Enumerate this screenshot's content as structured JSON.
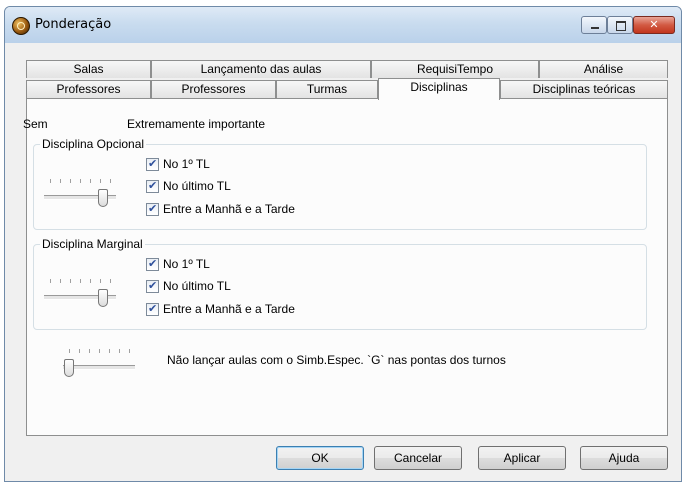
{
  "window": {
    "title": "Ponderação",
    "controls": {
      "minimize": "minimize",
      "maximize": "maximize",
      "close": "close"
    }
  },
  "tabs": {
    "row1": [
      "Salas",
      "Lançamento das aulas",
      "RequisiTempo",
      "Análise"
    ],
    "row2": [
      "Professores",
      "Professores",
      "Turmas",
      "Disciplinas",
      "Disciplinas teóricas"
    ],
    "active": "Disciplinas"
  },
  "panel": {
    "scale_min_label": "Sem",
    "scale_max_label": "Extremamente importante",
    "group_opcional": {
      "title": "Disciplina Opcional",
      "slider_value": 0.85,
      "checks": [
        {
          "label": "No 1º TL",
          "checked": true
        },
        {
          "label": "No último TL",
          "checked": true
        },
        {
          "label": "Entre a Manhã e a Tarde",
          "checked": true
        }
      ]
    },
    "group_marginal": {
      "title": "Disciplina Marginal",
      "slider_value": 0.85,
      "checks": [
        {
          "label": "No 1º TL",
          "checked": true
        },
        {
          "label": "No último TL",
          "checked": true
        },
        {
          "label": "Entre a Manhã e a Tarde",
          "checked": true
        }
      ]
    },
    "simb_slider_value": 0.0,
    "simb_label": "Não lançar aulas com o Simb.Espec. `G` nas pontas dos turnos"
  },
  "buttons": {
    "ok": "OK",
    "cancel": "Cancelar",
    "apply": "Aplicar",
    "help": "Ajuda"
  }
}
